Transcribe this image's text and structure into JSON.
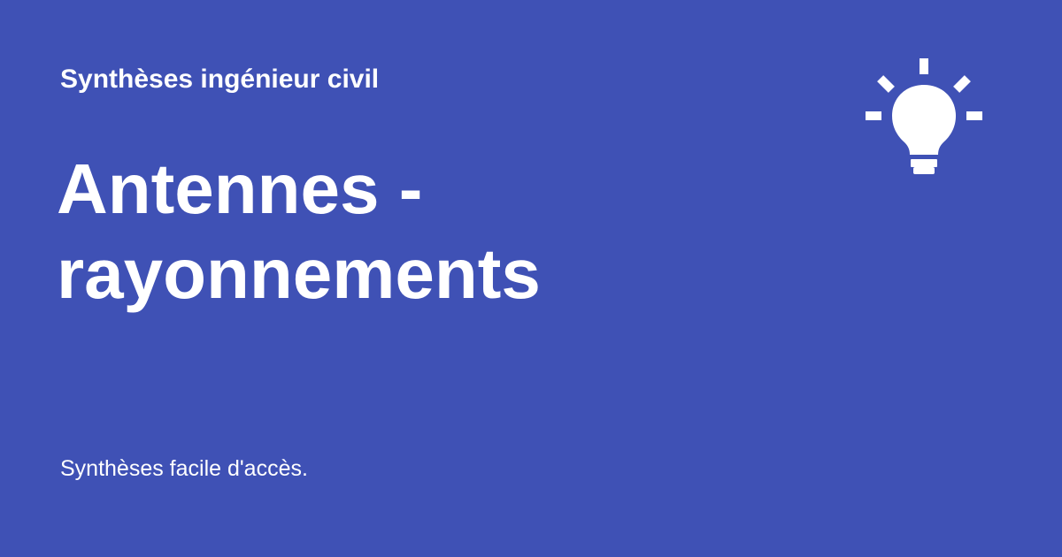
{
  "header": {
    "site_name": "Synthèses ingénieur civil"
  },
  "main": {
    "title": "Antennes - rayonnements"
  },
  "footer": {
    "tagline": "Synthèses facile d'accès."
  },
  "icons": {
    "logo": "lightbulb-icon"
  },
  "colors": {
    "background": "#3f51b5",
    "text": "#ffffff"
  }
}
